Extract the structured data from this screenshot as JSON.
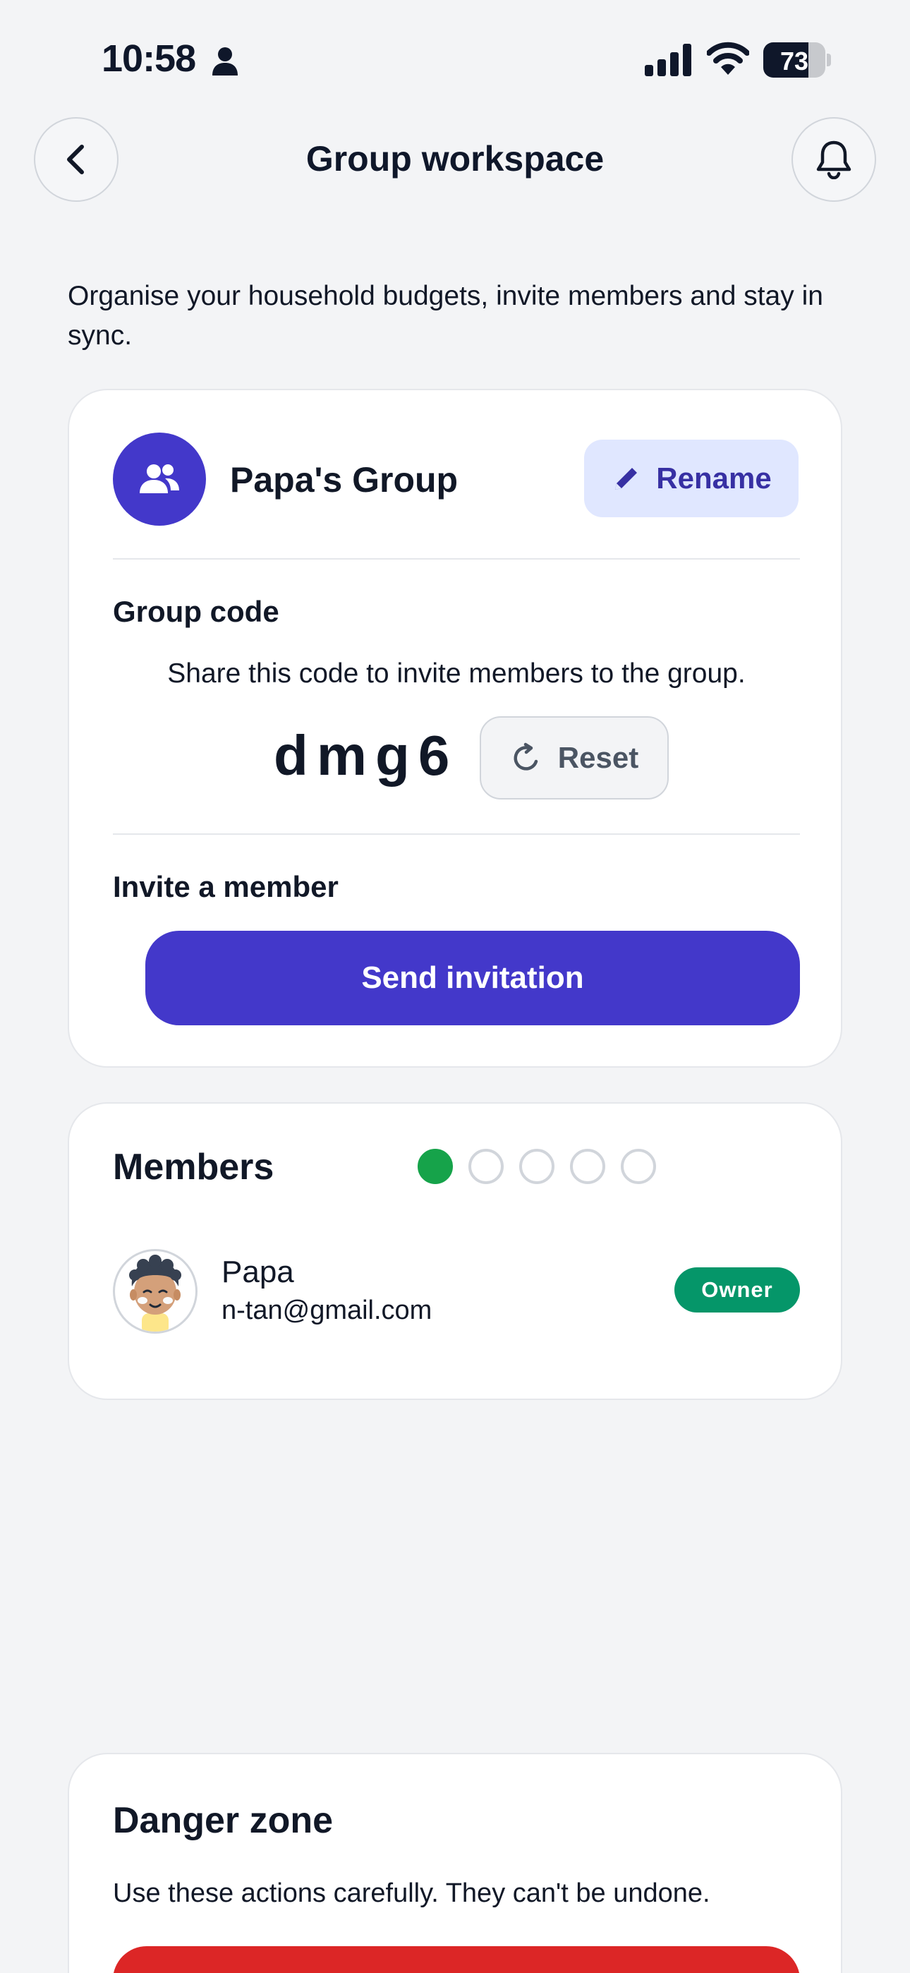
{
  "status_bar": {
    "time": "10:58",
    "battery_percent": "73",
    "battery_level": 0.73,
    "icons": [
      "person-icon",
      "signal-icon",
      "wifi-icon",
      "battery-icon"
    ]
  },
  "header": {
    "title": "Group workspace",
    "back_icon": "chevron-left-icon",
    "notification_icon": "bell-icon"
  },
  "intro_text": "Organise your household budgets, invite members and stay in sync.",
  "group": {
    "name": "Papa's Group",
    "avatar_icon": "users-icon",
    "rename_label": "Rename",
    "rename_icon": "pencil-icon",
    "code_label": "Group code",
    "code_hint": "Share this code to invite members to the group.",
    "code": "dmg6",
    "reset_label": "Reset",
    "reset_icon": "refresh-icon",
    "invite_label": "Invite a member",
    "send_label": "Send invitation"
  },
  "members": {
    "title": "Members",
    "slots_total": 5,
    "slots_filled": 1,
    "list": [
      {
        "name": "Papa",
        "email": "n-tan@gmail.com",
        "role": "Owner"
      }
    ]
  },
  "danger": {
    "title": "Danger zone",
    "description": "Use these actions carefully. They can't be undone."
  },
  "colors": {
    "accent": "#4338ca",
    "accent_soft": "#e0e7ff",
    "success": "#16a34a",
    "owner_badge": "#059669",
    "danger": "#dc2626",
    "background": "#f3f4f6"
  }
}
